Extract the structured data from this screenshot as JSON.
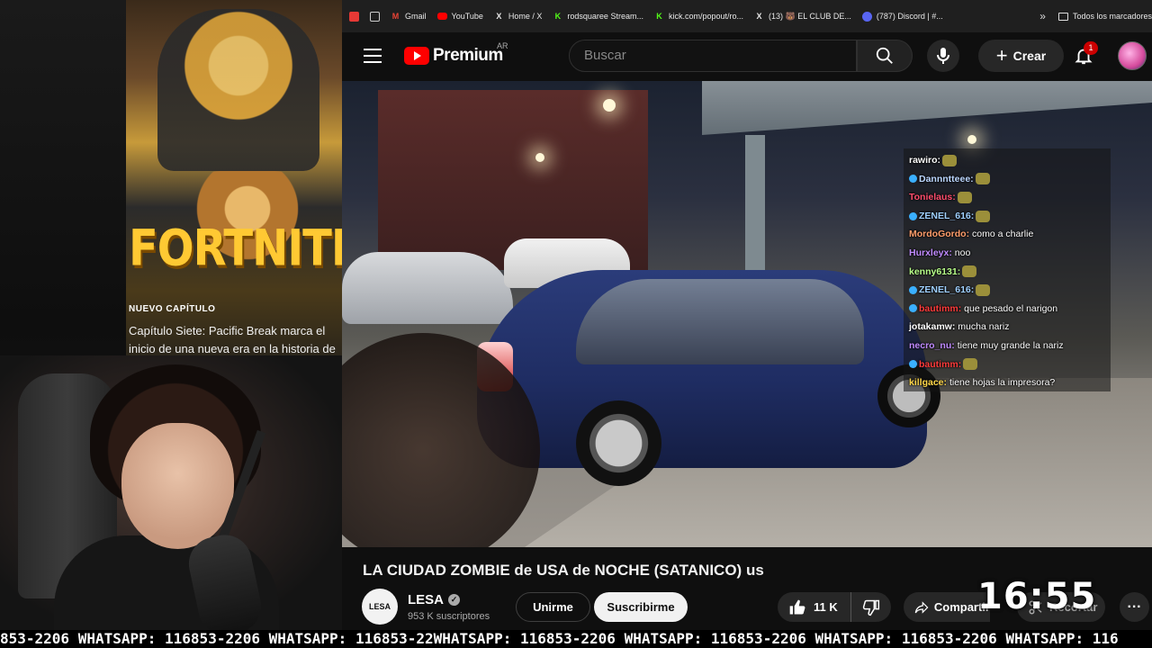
{
  "bookmarks": {
    "items": [
      {
        "label": "",
        "icon": "red-square-icon",
        "color": "#e53935"
      },
      {
        "label": "",
        "icon": "apps-grid-icon",
        "color": "#cccccc"
      },
      {
        "label": "Gmail",
        "icon": "gmail-icon",
        "color": "#ea4335"
      },
      {
        "label": "YouTube",
        "icon": "youtube-icon",
        "color": "#ff0000"
      },
      {
        "label": "Home / X",
        "icon": "x-icon",
        "color": "#ffffff"
      },
      {
        "label": "rodsquaree Stream...",
        "icon": "kick-icon",
        "color": "#53fc18"
      },
      {
        "label": "kick.com/popout/ro...",
        "icon": "kick-icon",
        "color": "#53fc18"
      },
      {
        "label": "(13) 🐻 EL CLUB DE...",
        "icon": "x-icon",
        "color": "#ffffff"
      },
      {
        "label": "(787) Discord | #...",
        "icon": "discord-icon",
        "color": "#5865f2"
      }
    ],
    "overflow": "»",
    "folder_label": "Todos los marcadores"
  },
  "left_panel": {
    "game_logo": "FORTNITE",
    "section_label": "NUEVO CAPÍTULO",
    "description": "Capítulo Siete: Pacific Break marca el inicio de una nueva era en la historia de Fortnite B... donde se cuentan las mejores ... Dorada."
  },
  "header": {
    "logo_text": "Premium",
    "region": "AR",
    "search_placeholder": "Buscar",
    "create_label": "Crear",
    "notification_count": "1"
  },
  "chat": {
    "messages": [
      {
        "user": "rawiro:",
        "text": "",
        "color": "#ffffff",
        "emote": true,
        "badge": false
      },
      {
        "user": "Dannntteee:",
        "text": "",
        "color": "#bcd7ff",
        "emote": true,
        "badge": true
      },
      {
        "user": "Tonielaus:",
        "text": "",
        "color": "#ff4d6d",
        "emote": true,
        "badge": false
      },
      {
        "user": "ZENEL_616:",
        "text": "",
        "color": "#9fd0ff",
        "emote": true,
        "badge": true
      },
      {
        "user": "MordoGordo:",
        "text": "como a charlie",
        "color": "#ff9d6b",
        "emote": false,
        "badge": false
      },
      {
        "user": "Hurxleyx:",
        "text": "noo",
        "color": "#c08bff",
        "emote": false,
        "badge": false
      },
      {
        "user": "kenny6131:",
        "text": "",
        "color": "#b8ff8a",
        "emote": true,
        "badge": false
      },
      {
        "user": "ZENEL_616:",
        "text": "",
        "color": "#9fd0ff",
        "emote": true,
        "badge": true
      },
      {
        "user": "bautimm:",
        "text": "que pesado el narigon",
        "color": "#ff3b3b",
        "emote": false,
        "badge": true
      },
      {
        "user": "jotakamw:",
        "text": "mucha nariz",
        "color": "#ffffff",
        "emote": false,
        "badge": false
      },
      {
        "user": "necro_nu:",
        "text": "tiene muy grande la nariz",
        "color": "#c08bff",
        "emote": false,
        "badge": false
      },
      {
        "user": "bautimm:",
        "text": "",
        "color": "#ff3b3b",
        "emote": true,
        "badge": true
      },
      {
        "user": "killgace:",
        "text": "tiene hojas la impresora?",
        "color": "#ffd84a",
        "emote": false,
        "badge": false
      }
    ]
  },
  "video": {
    "title": "LA CIUDAD ZOMBIE de USA de NOCHE (SATANICO) us",
    "channel_name": "LESA",
    "channel_avatar_text": "LESA",
    "subscribers": "953 K suscriptores",
    "join_label": "Unirme",
    "subscribe_label": "Suscribirme",
    "likes": "11 K",
    "share_label": "Compartir",
    "clip_label": "Recortar",
    "more_label": "···"
  },
  "overlay": {
    "clock": "16:55",
    "ticker": "853-2206 WHATSAPP: 116853-2206 WHATSAPP: 116853-22WHATSAPP: 116853-2206 WHATSAPP: 116853-2206 WHATSAPP: 116853-2206 WHATSAPP: 116"
  },
  "colors": {
    "accent": "#ff0000",
    "background": "#0f0f0f",
    "button": "#272727"
  }
}
